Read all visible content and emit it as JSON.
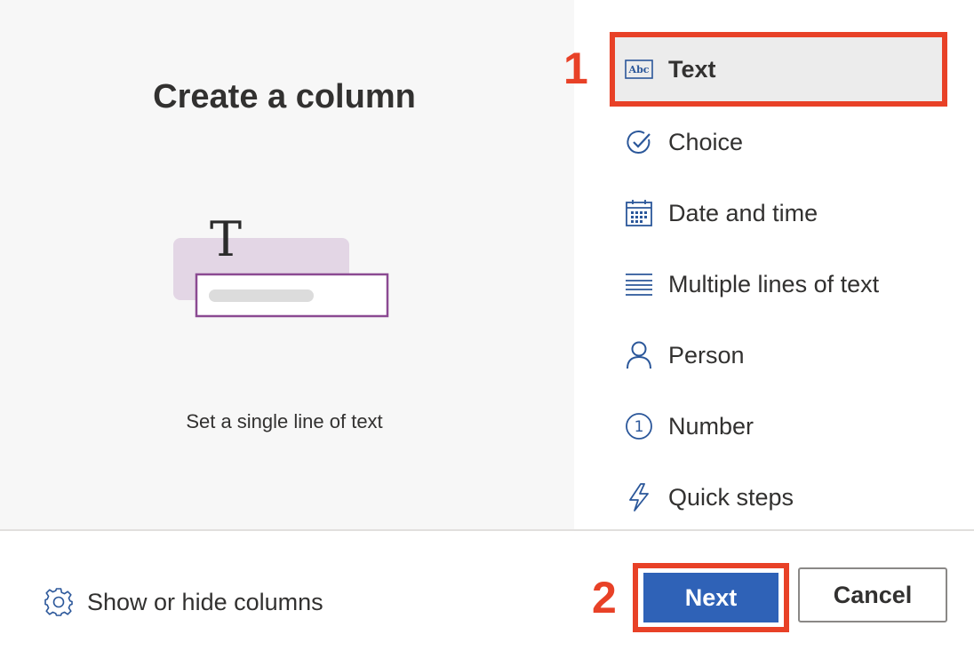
{
  "dialog": {
    "title": "Create a column",
    "description": "Set a single line of text",
    "illustration_glyph": "T"
  },
  "column_types": [
    {
      "label": "Text",
      "icon": "abc-text-icon",
      "icon_text": "Abc",
      "selected": true
    },
    {
      "label": "Choice",
      "icon": "check-circle-icon",
      "selected": false
    },
    {
      "label": "Date and time",
      "icon": "calendar-icon",
      "selected": false
    },
    {
      "label": "Multiple lines of text",
      "icon": "multiline-text-icon",
      "selected": false
    },
    {
      "label": "Person",
      "icon": "person-icon",
      "selected": false
    },
    {
      "label": "Number",
      "icon": "number-icon",
      "icon_text": "1",
      "selected": false
    },
    {
      "label": "Quick steps",
      "icon": "lightning-icon",
      "selected": false
    }
  ],
  "annotations": {
    "marker_1": "1",
    "marker_2": "2"
  },
  "footer": {
    "show_hide_label": "Show or hide columns",
    "show_hide_icon": "gear-icon",
    "next_label": "Next",
    "cancel_label": "Cancel"
  },
  "colors": {
    "accent_blue": "#2f62b7",
    "highlight_red": "#e84127",
    "icon_blue": "#2b579a",
    "illustration_purple": "#8b4a92"
  }
}
